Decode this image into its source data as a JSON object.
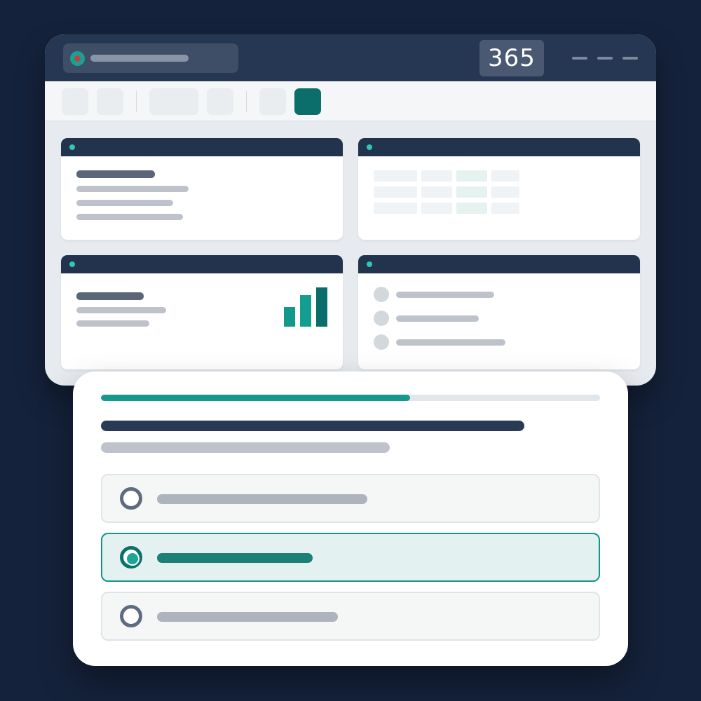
{
  "titlebar": {
    "counter_value": "365",
    "search_icon": "search-icon",
    "window_controls": [
      "minimize",
      "maximize",
      "close"
    ]
  },
  "toolbar": {
    "buttons": [
      {
        "name": "tool-button-1",
        "active": false
      },
      {
        "name": "tool-button-2",
        "active": false
      },
      {
        "name": "tool-button-3",
        "active": false
      },
      {
        "name": "tool-button-4",
        "active": false
      },
      {
        "name": "tool-button-5",
        "active": false
      },
      {
        "name": "tool-button-6",
        "active": true
      }
    ],
    "active_color": "#0c6e6a"
  },
  "dashboard": {
    "cards": [
      "text-card",
      "table-card",
      "chart-card",
      "list-card"
    ],
    "chart_bars": [
      0.5,
      0.8,
      1.0
    ],
    "chart_colors": [
      "#12998c",
      "#139e8f",
      "#0b6d69"
    ]
  },
  "quiz": {
    "progress": 0.62,
    "selected_option": 1,
    "option_count": 3
  },
  "colors": {
    "background": "#15223b",
    "accent": "#16998c",
    "header": "#263754"
  }
}
